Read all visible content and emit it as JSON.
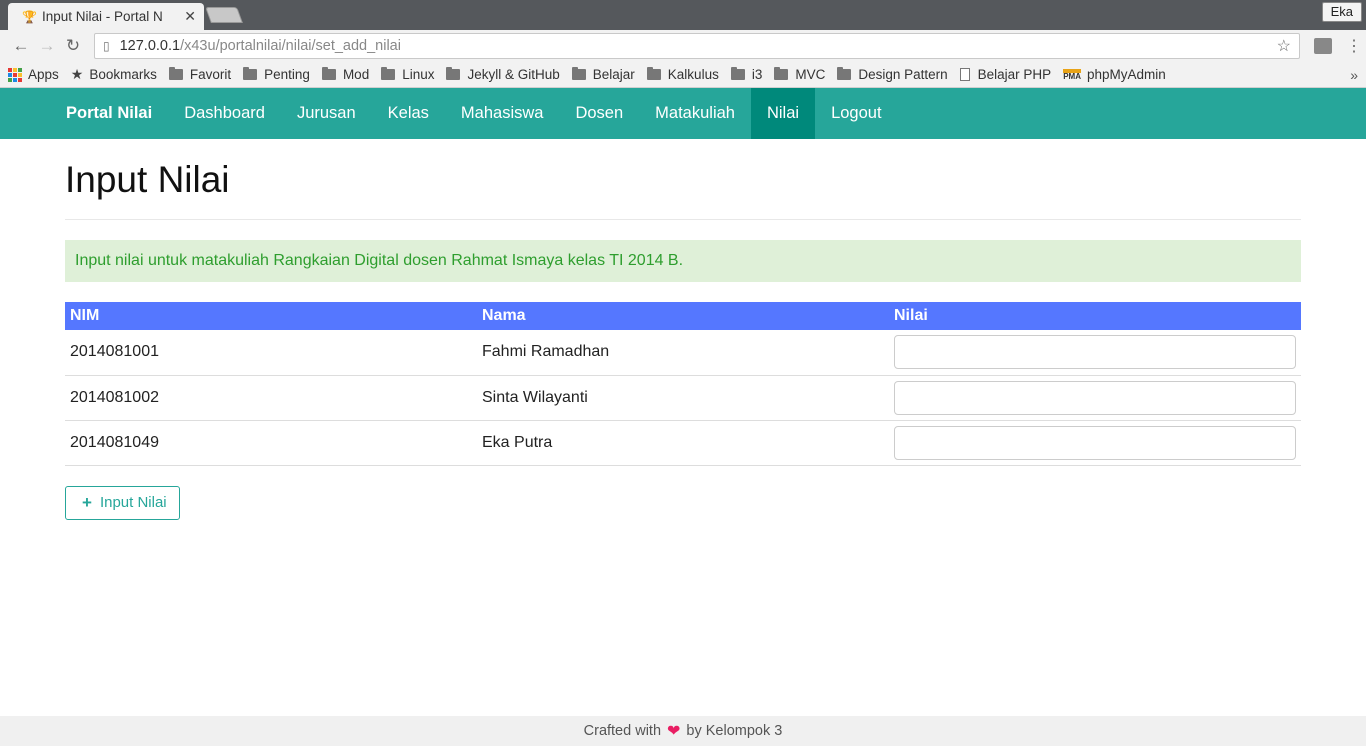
{
  "browser": {
    "tab_title": "Input Nilai - Portal N",
    "profile": "Eka",
    "url_host": "127.0.0.1",
    "url_path": "/x43u/portalnilai/nilai/set_add_nilai",
    "bookmarks": [
      {
        "label": "Apps",
        "icon": "apps-grid-icon"
      },
      {
        "label": "Bookmarks",
        "icon": "star-icon"
      },
      {
        "label": "Favorit",
        "icon": "folder-icon"
      },
      {
        "label": "Penting",
        "icon": "folder-icon"
      },
      {
        "label": "Mod",
        "icon": "folder-icon"
      },
      {
        "label": "Linux",
        "icon": "folder-icon"
      },
      {
        "label": "Jekyll & GitHub",
        "icon": "folder-icon"
      },
      {
        "label": "Belajar",
        "icon": "folder-icon"
      },
      {
        "label": "Kalkulus",
        "icon": "folder-icon"
      },
      {
        "label": "i3",
        "icon": "folder-icon"
      },
      {
        "label": "MVC",
        "icon": "folder-icon"
      },
      {
        "label": "Design Pattern",
        "icon": "folder-icon"
      },
      {
        "label": "Belajar PHP",
        "icon": "page-icon"
      },
      {
        "label": "phpMyAdmin",
        "icon": "pma-icon"
      }
    ],
    "more": "»"
  },
  "navbar": {
    "brand": "Portal Nilai",
    "items": [
      "Dashboard",
      "Jurusan",
      "Kelas",
      "Mahasiswa",
      "Dosen",
      "Matakuliah",
      "Nilai",
      "Logout"
    ],
    "active": "Nilai",
    "color": "#26a69a",
    "active_color": "#00897b"
  },
  "page": {
    "title": "Input Nilai",
    "alert": "Input nilai untuk matakuliah Rangkaian Digital dosen Rahmat Ismaya kelas TI 2014 B.",
    "table": {
      "headers": [
        "NIM",
        "Nama",
        "Nilai"
      ],
      "rows": [
        {
          "nim": "2014081001",
          "nama": "Fahmi Ramadhan",
          "nilai": ""
        },
        {
          "nim": "2014081002",
          "nama": "Sinta Wilayanti",
          "nilai": ""
        },
        {
          "nim": "2014081049",
          "nama": "Eka Putra",
          "nilai": ""
        }
      ],
      "header_color": "#5577ff"
    },
    "submit_label": "Input Nilai"
  },
  "footer": {
    "prefix": "Crafted with",
    "suffix": "by Kelompok 3"
  }
}
